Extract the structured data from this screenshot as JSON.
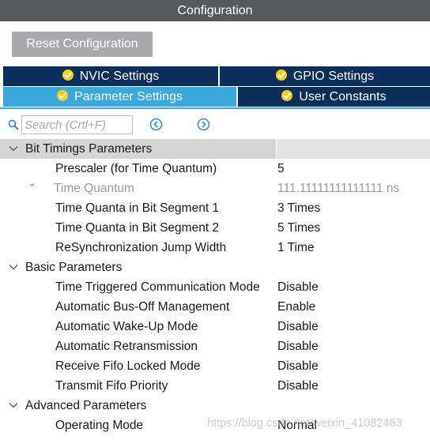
{
  "window": {
    "title": "Configuration"
  },
  "toolbar": {
    "reset_label": "Reset Configuration"
  },
  "tabs": [
    {
      "label": "NVIC Settings",
      "state": "inactive"
    },
    {
      "label": "GPIO Settings",
      "state": "inactive"
    },
    {
      "label": "Parameter Settings",
      "state": "active"
    },
    {
      "label": "User Constants",
      "state": "inactive"
    }
  ],
  "search": {
    "placeholder": "Search (Crtl+F)",
    "value": ""
  },
  "groups": [
    {
      "label": "Bit Timings Parameters",
      "params": [
        {
          "label": "Prescaler (for Time Quantum)",
          "value": "5"
        },
        {
          "label": "Time Quantum",
          "value": "111.11111111111111 ns",
          "marker": "*"
        },
        {
          "label": "Time Quanta in Bit Segment 1",
          "value": "3 Times"
        },
        {
          "label": "Time Quanta in Bit Segment 2",
          "value": "5 Times"
        },
        {
          "label": "ReSynchronization Jump Width",
          "value": "1 Time"
        }
      ]
    },
    {
      "label": "Basic Parameters",
      "params": [
        {
          "label": "Time Triggered Communication Mode",
          "value": "Disable"
        },
        {
          "label": "Automatic Bus-Off Management",
          "value": "Enable"
        },
        {
          "label": "Automatic Wake-Up Mode",
          "value": "Disable"
        },
        {
          "label": "Automatic Retransmission",
          "value": "Disable"
        },
        {
          "label": "Receive Fifo Locked Mode",
          "value": "Disable"
        },
        {
          "label": "Transmit Fifo Priority",
          "value": "Disable"
        }
      ]
    },
    {
      "label": "Advanced Parameters",
      "params": [
        {
          "label": "Operating Mode",
          "value": "Normal"
        }
      ]
    }
  ],
  "watermark": "https://blog.csdn.net/weixin_41082463",
  "colors": {
    "titlebar": "#58595b",
    "tab_dark": "#0b2e5b",
    "tab_active": "#39a9dc",
    "check_badge": "#f2cf1d",
    "button": "#a7a9ac"
  }
}
